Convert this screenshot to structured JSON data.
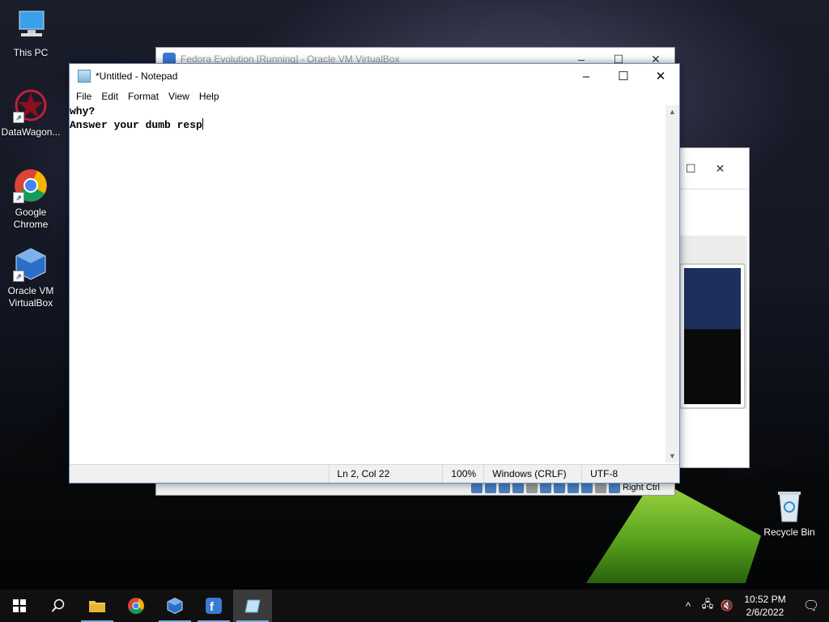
{
  "desktop": {
    "icons": [
      {
        "label": "This PC"
      },
      {
        "label": "DataWagon..."
      },
      {
        "label": "Google Chrome"
      },
      {
        "label": "Oracle VM VirtualBox"
      },
      {
        "label": "Recycle Bin"
      }
    ]
  },
  "vbox_window": {
    "title": "Fedora Evolution [Running] - Oracle VM VirtualBox",
    "host_key": "Right Ctrl"
  },
  "notepad": {
    "title": "*Untitled - Notepad",
    "menu": [
      "File",
      "Edit",
      "Format",
      "View",
      "Help"
    ],
    "lines": [
      "why?",
      "Answer your dumb resp"
    ],
    "status": {
      "position": "Ln 2, Col 22",
      "zoom": "100%",
      "line_ending": "Windows (CRLF)",
      "encoding": "UTF-8"
    }
  },
  "taskbar": {
    "clock": {
      "time": "10:52 PM",
      "date": "2/6/2022"
    }
  }
}
